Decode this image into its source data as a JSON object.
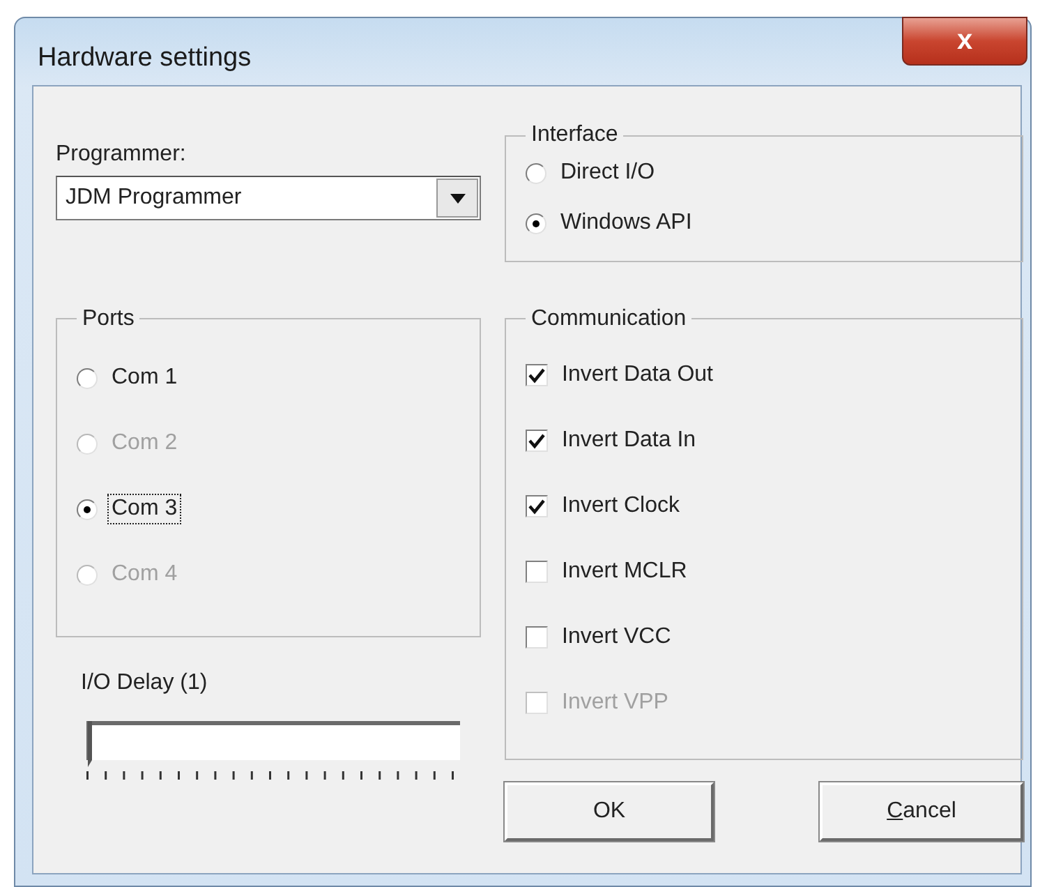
{
  "window": {
    "title": "Hardware settings",
    "close": "x"
  },
  "programmer": {
    "label": "Programmer:",
    "value": "JDM Programmer"
  },
  "interface": {
    "title": "Interface",
    "options": [
      {
        "label": "Direct I/O",
        "selected": false,
        "disabled": false,
        "focused": false
      },
      {
        "label": "Windows API",
        "selected": true,
        "disabled": false,
        "focused": false
      }
    ]
  },
  "ports": {
    "title": "Ports",
    "options": [
      {
        "label": "Com 1",
        "selected": false,
        "disabled": false,
        "focused": false
      },
      {
        "label": "Com 2",
        "selected": false,
        "disabled": true,
        "focused": false
      },
      {
        "label": "Com 3",
        "selected": true,
        "disabled": false,
        "focused": true
      },
      {
        "label": "Com 4",
        "selected": false,
        "disabled": true,
        "focused": false
      }
    ]
  },
  "io_delay": {
    "label": "I/O Delay (1)",
    "level": 0
  },
  "communication": {
    "title": "Communication",
    "options": [
      {
        "label": "Invert Data Out",
        "checked": true,
        "disabled": false
      },
      {
        "label": "Invert Data In",
        "checked": true,
        "disabled": false
      },
      {
        "label": "Invert Clock",
        "checked": true,
        "disabled": false
      },
      {
        "label": "Invert MCLR",
        "checked": false,
        "disabled": false
      },
      {
        "label": "Invert VCC",
        "checked": false,
        "disabled": false
      },
      {
        "label": "Invert VPP",
        "checked": false,
        "disabled": true
      }
    ]
  },
  "buttons": [
    {
      "label": "OK"
    },
    {
      "mnemonic": "C",
      "label": "ancel"
    }
  ]
}
